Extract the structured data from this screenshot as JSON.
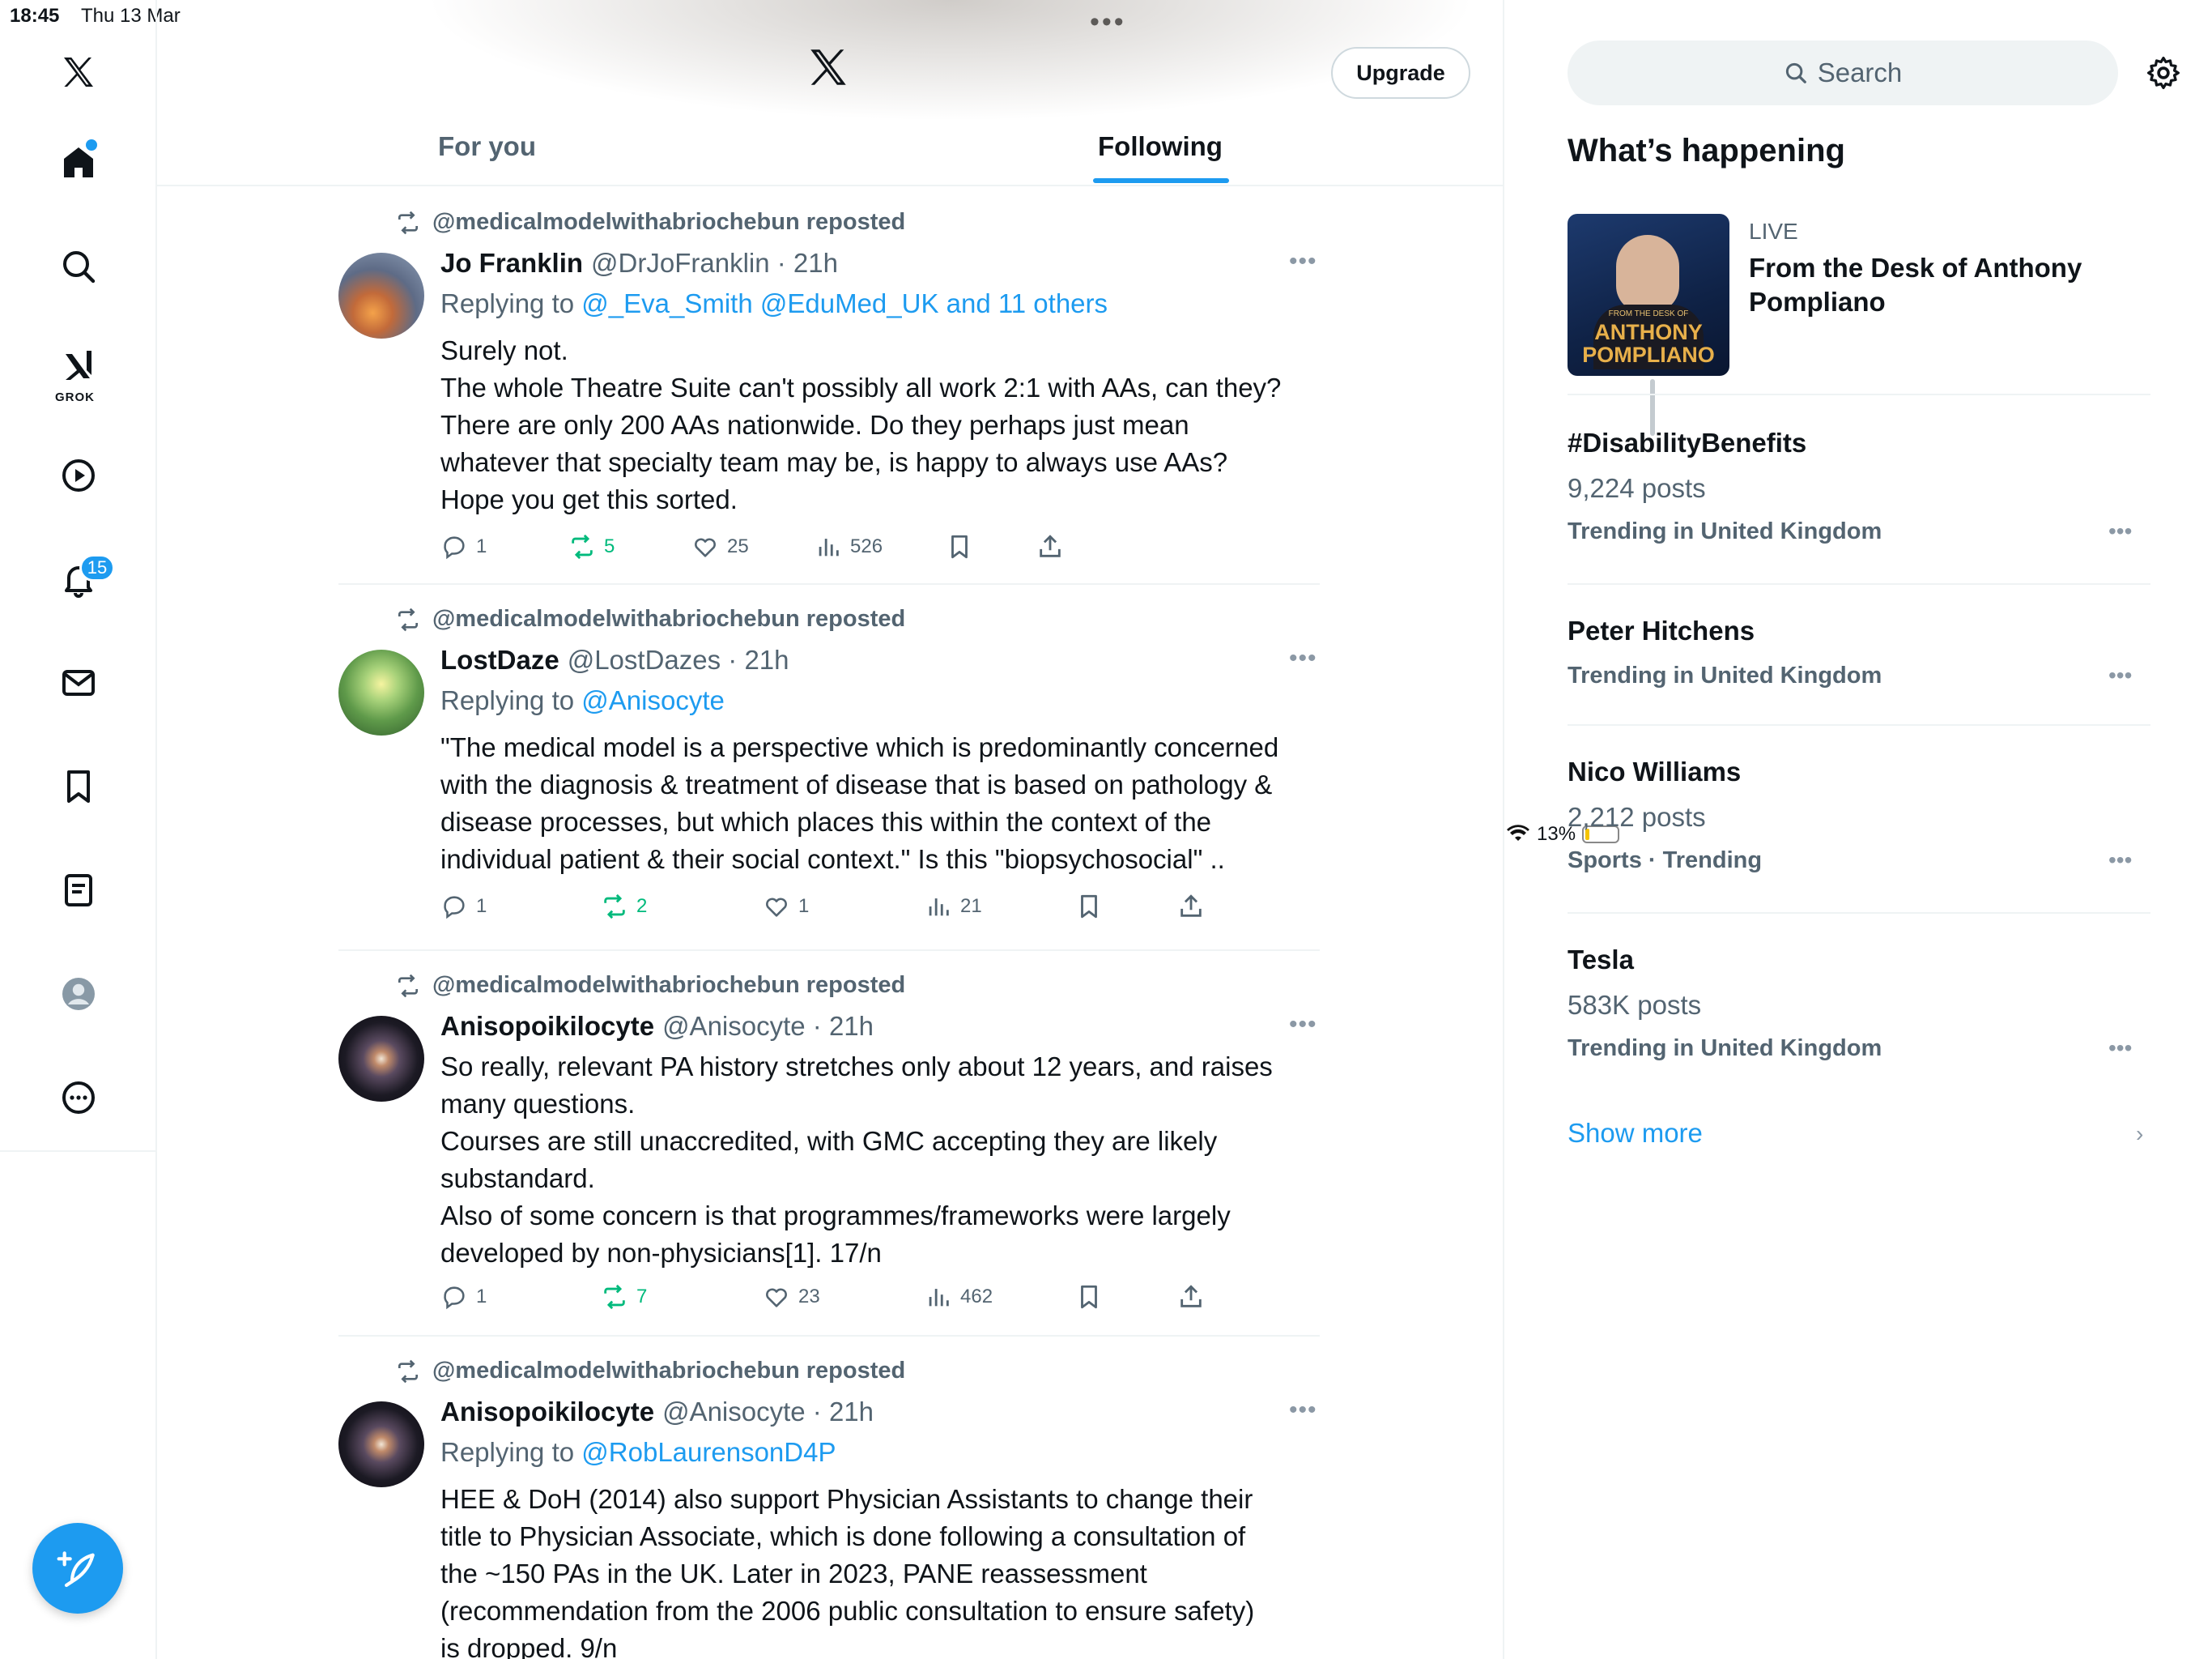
{
  "status_bar": {
    "time": "18:45",
    "date": "Thu 13 Mar",
    "battery": "13%",
    "battery_level": 0.13
  },
  "nav": {
    "grok_label": "GROK",
    "notifications_badge": "15"
  },
  "header": {
    "upgrade_label": "Upgrade",
    "tabs": [
      {
        "label": "For you"
      },
      {
        "label": "Following"
      }
    ]
  },
  "tweets": [
    {
      "reposted_by": "@medicalmodelwithabriochebun reposted",
      "name": "Jo Franklin",
      "handle": "@DrJoFranklin · 21h",
      "replying_prefix": "Replying to",
      "replying_links": "@_Eva_Smith @EduMed_UK and 11 others",
      "lines": [
        "Surely not.",
        "The whole Theatre Suite can't possibly all work 2:1 with AAs, can they?",
        "There are only 200 AAs nationwide. Do they perhaps just mean",
        "whatever that specialty team may be, is happy to always use AAs?",
        "Hope you get this sorted."
      ],
      "replies": "1",
      "reposts": "5",
      "likes": "25",
      "views": "526"
    },
    {
      "reposted_by": "@medicalmodelwithabriochebun reposted",
      "name": "LostDaze",
      "handle": "@LostDazes · 21h",
      "replying_prefix": "Replying to",
      "replying_links": "@Anisocyte",
      "lines": [
        "\"The medical model is a perspective which is predominantly concerned",
        "with the diagnosis & treatment of disease that is based on pathology &",
        "disease processes, but which places this within the context of the",
        "individual patient & their social context.\" Is this \"biopsychosocial\" .."
      ],
      "replies": "1",
      "reposts": "2",
      "likes": "1",
      "views": "21"
    },
    {
      "reposted_by": "@medicalmodelwithabriochebun reposted",
      "name": "Anisopoikilocyte",
      "handle": "@Anisocyte · 21h",
      "lines": [
        "So really, relevant PA history stretches only about 12 years, and raises",
        "many questions.",
        "Courses are still unaccredited, with GMC accepting they are likely",
        "substandard.",
        "Also of some concern is that programmes/frameworks were largely",
        "developed by non-physicians[1]. 17/n"
      ],
      "replies": "1",
      "reposts": "7",
      "likes": "23",
      "views": "462"
    },
    {
      "reposted_by": "@medicalmodelwithabriochebun reposted",
      "name": "Anisopoikilocyte",
      "handle": "@Anisocyte · 21h",
      "replying_prefix": "Replying to",
      "replying_links": "@RobLaurensonD4P",
      "lines": [
        "HEE & DoH (2014) also support Physician Assistants to change their",
        "title to Physician Associate, which is done following a consultation of",
        "the ~150 PAs in the UK. Later in 2023, PANE reassessment",
        "(recommendation from the 2006 public consultation to ensure safety)",
        "is dropped. 9/n"
      ]
    }
  ],
  "sidebar": {
    "search_placeholder": "Search",
    "whats_happening": "What’s happening",
    "live": {
      "label": "LIVE",
      "title": "From the Desk of Anthony Pompliano",
      "thumb_small": "FROM THE DESK OF",
      "thumb_big": "ANTHONY POMPLIANO"
    },
    "trends": [
      {
        "title": "#DisabilityBenefits",
        "posts": "9,224 posts",
        "context": "Trending in United Kingdom"
      },
      {
        "title": "Peter Hitchens",
        "posts": "",
        "context": "Trending in United Kingdom"
      },
      {
        "title": "Nico Williams",
        "posts": "2,212 posts",
        "context": "Sports · Trending"
      },
      {
        "title": "Tesla",
        "posts": "583K posts",
        "context": "Trending in United Kingdom"
      }
    ],
    "show_more": "Show more"
  },
  "colors": {
    "accent": "#1d9bf0",
    "repost_green": "#00ba7c",
    "muted": "#536471"
  }
}
